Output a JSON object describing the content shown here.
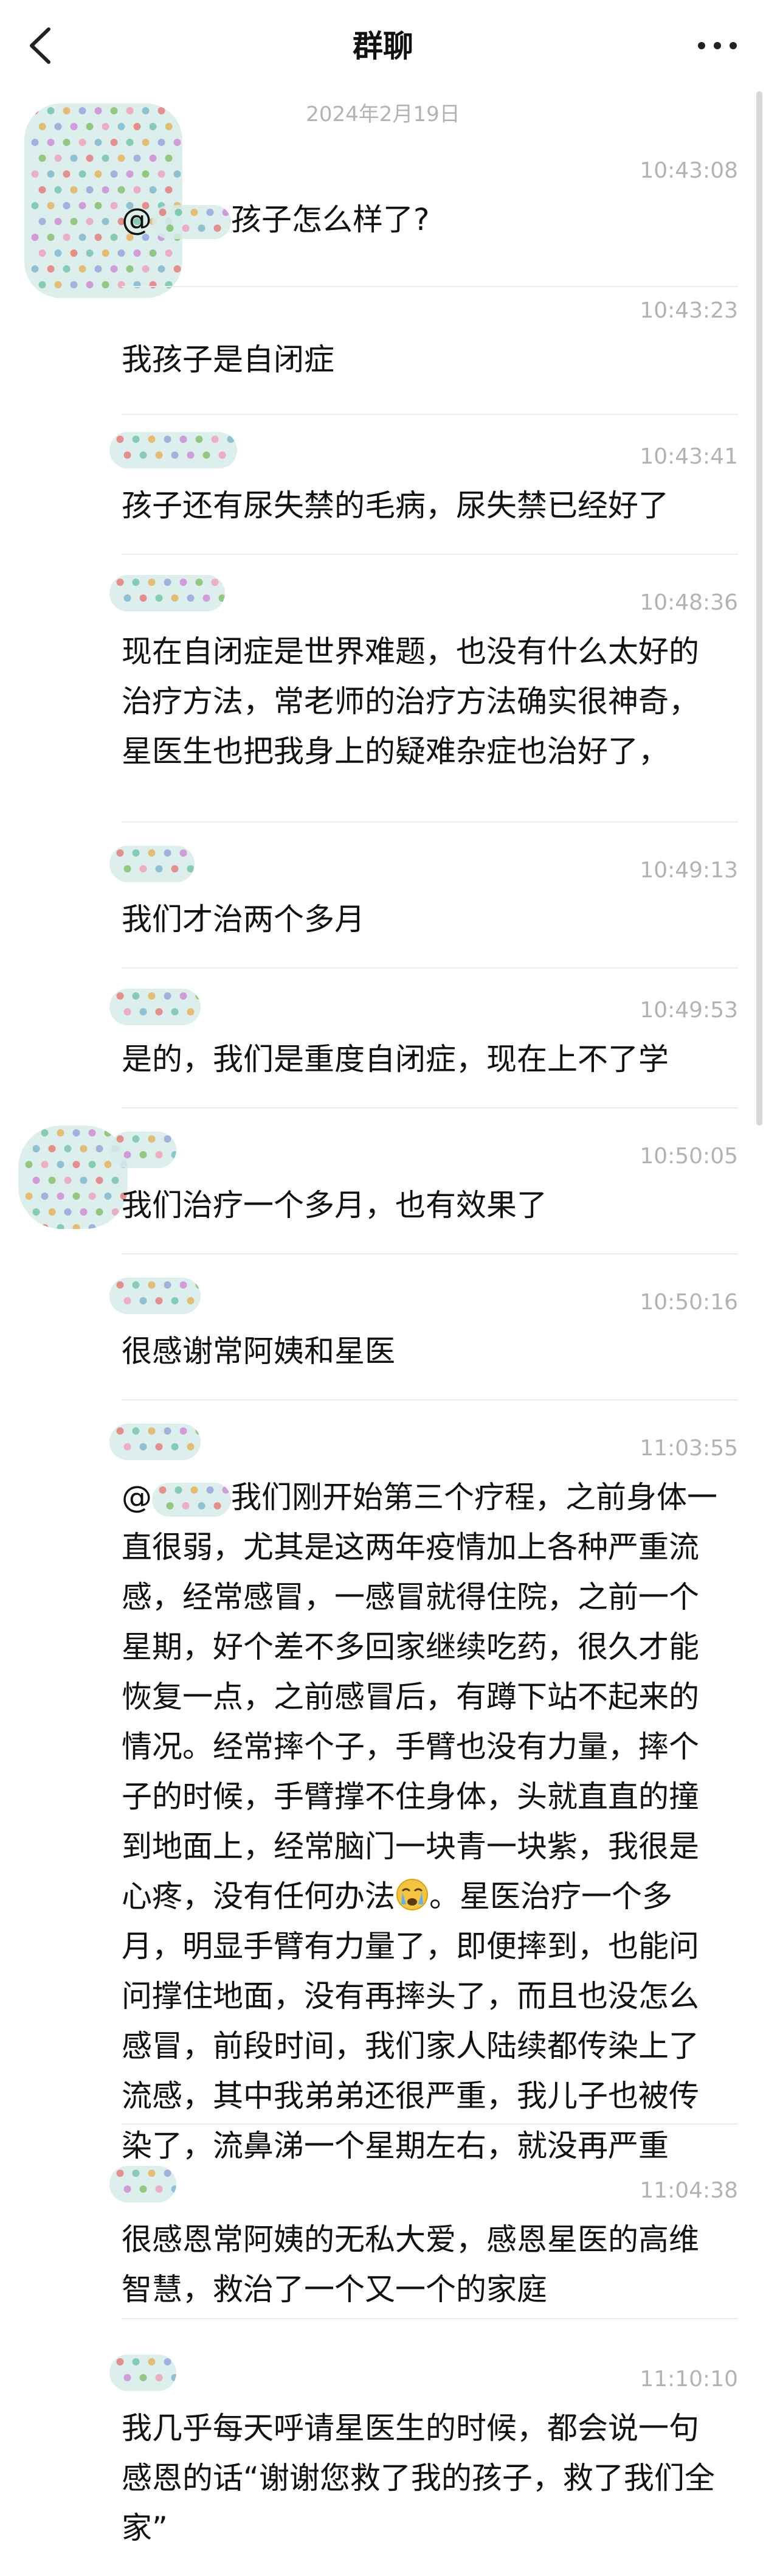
{
  "header": {
    "title": "群聊"
  },
  "date": "2024年2月19日",
  "messages": [
    {
      "time": "10:43:08",
      "mention": "@",
      "text": "孩子怎么样了?"
    },
    {
      "time": "10:43:23",
      "text": "我孩子是自闭症"
    },
    {
      "time": "10:43:41",
      "text": "孩子还有尿失禁的毛病，尿失禁已经好了"
    },
    {
      "time": "10:48:36",
      "text": "现在自闭症是世界难题，也没有什么太好的治疗方法，常老师的治疗方法确实很神奇，星医生也把我身上的疑难杂症也治好了，"
    },
    {
      "time": "10:49:13",
      "text": "我们才治两个多月"
    },
    {
      "time": "10:49:53",
      "text": "是的，我们是重度自闭症，现在上不了学"
    },
    {
      "time": "10:50:05",
      "text": "我们治疗一个多月，也有效果了"
    },
    {
      "time": "10:50:16",
      "text": "很感谢常阿姨和星医"
    },
    {
      "time": "11:03:55",
      "mention": "@",
      "text": "我们刚开始第三个疗程，之前身体一直很弱，尤其是这两年疫情加上各种严重流感，经常感冒，一感冒就得住院，之前一个星期，好个差不多回家继续吃药，很久才能恢复一点，之前感冒后，有蹲下站不起来的情况。经常摔个子，手臂也没有力量，摔个子的时候，手臂撑不住身体，头就直直的撞到地面上，经常脑门一块青一块紫，我很是心疼，没有任何办法",
      "text2": "。星医治疗一个多月，明显手臂有力量了，即便摔到，也能问问撑住地面，没有再摔头了，而且也没怎么感冒，前段时间，我们家人陆续都传染上了流感，其中我弟弟还很严重，我儿子也被传染了，流鼻涕一个星期左右，就没再严重"
    },
    {
      "time": "11:04:38",
      "text": "很感恩常阿姨的无私大爱，感恩星医的高维智慧，救治了一个又一个的家庭"
    },
    {
      "time": "11:10:10",
      "text": "我几乎每天呼请星医生的时候，都会说一句感恩的话“谢谢您救了我的孩子，救了我们全家”"
    }
  ]
}
